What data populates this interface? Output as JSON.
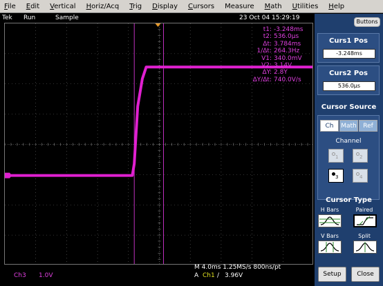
{
  "menu": [
    {
      "label": "File",
      "u": "F",
      "rest": "ile"
    },
    {
      "label": "Edit",
      "u": "E",
      "rest": "dit"
    },
    {
      "label": "Vertical",
      "u": "V",
      "rest": "ertical"
    },
    {
      "label": "Horiz/Acq",
      "u": "H",
      "rest": "oriz/Acq"
    },
    {
      "label": "Trig",
      "u": "T",
      "rest": "rig"
    },
    {
      "label": "Display",
      "u": "D",
      "rest": "isplay"
    },
    {
      "label": "Cursors",
      "u": "C",
      "rest": "ursors"
    },
    {
      "label": "Measure",
      "u": "",
      "rest": "Measure"
    },
    {
      "label": "Math",
      "u": "M",
      "rest": "ath"
    },
    {
      "label": "Utilities",
      "u": "U",
      "rest": "tilities"
    },
    {
      "label": "Help",
      "u": "H",
      "rest": "elp"
    }
  ],
  "status": {
    "brand": "Tek",
    "run": "Run",
    "mode": "Sample",
    "datetime": "23 Oct 04 15:29:19"
  },
  "readout": [
    {
      "k": "t1:",
      "v": "-3.248ms"
    },
    {
      "k": "t2:",
      "v": "536.0µs"
    },
    {
      "k": "Δt:",
      "v": "3.784ms"
    },
    {
      "k": "1/Δt:",
      "v": "264.3Hz"
    },
    {
      "k": "V1:",
      "v": "340.0mV"
    },
    {
      "k": "V2:",
      "v": "3.14V"
    },
    {
      "k": "ΔY:",
      "v": "2.8Y"
    },
    {
      "k": "ΔY/Δt:",
      "v": "740.0V/s"
    }
  ],
  "bottom": {
    "ch": "Ch3",
    "scale": "1.0V",
    "timebase": "M 4.0ms 1.25MS/s  800ns/pt",
    "trigger_prefix": "A",
    "trigger_ch": "Ch1",
    "trigger_slope": "/",
    "trigger_level": "3.96V"
  },
  "panel": {
    "buttons_label": "Buttons",
    "curs1_title": "Curs1 Pos",
    "curs1_value": "-3.248ms",
    "curs2_title": "Curs2 Pos",
    "curs2_value": "536.0µs",
    "cursor_source_title": "Cursor Source",
    "tabs": [
      "Ch",
      "Math",
      "Ref"
    ],
    "channel_label": "Channel",
    "channels": [
      "1",
      "2",
      "3",
      "4"
    ],
    "cursor_type_title": "Cursor Type",
    "types": [
      "H Bars",
      "Paired",
      "V Bars",
      "Split"
    ],
    "setup_label": "Setup",
    "close_label": "Close"
  },
  "colors": {
    "trace": "#e020d0",
    "cursor": "#c030c0",
    "panel_bg": "#1f3f6e",
    "grid": "#6a6a6a"
  },
  "chart_data": {
    "type": "line",
    "series": [
      {
        "values": [
          [
            -20,
            0
          ],
          [
            -3.5,
            0
          ],
          [
            -3.25,
            0.34
          ],
          [
            -2.8,
            2.0
          ],
          [
            -2.2,
            2.8
          ],
          [
            -1.7,
            3.14
          ],
          [
            20,
            3.14
          ]
        ]
      }
    ],
    "xlabel": "",
    "ylabel": "",
    "xlim": [
      -20,
      20
    ],
    "ylim": [
      -2.6,
      4.4
    ],
    "grid": true,
    "cursors_x": [
      -3.248,
      0.536
    ]
  }
}
